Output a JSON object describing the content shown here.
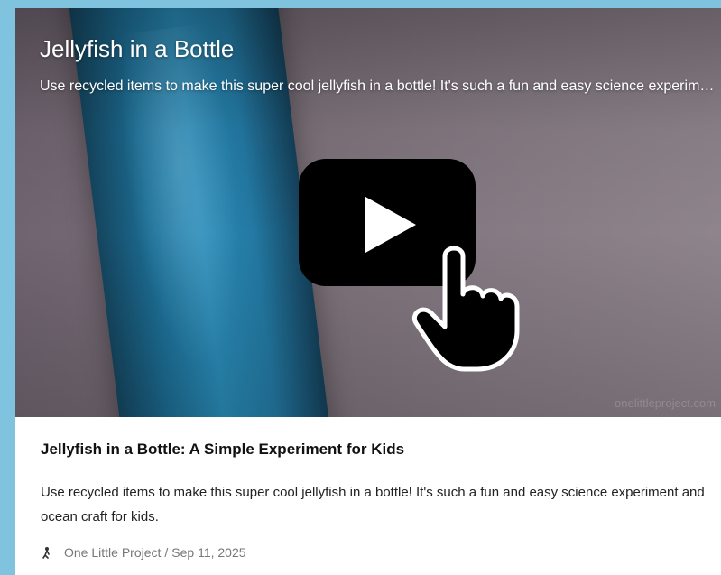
{
  "video": {
    "title": "Jellyfish in a Bottle",
    "subtitle": "Use recycled items to make this super cool jellyfish in a bottle! It's such a fun and easy science experiment and ocean craft for kids.",
    "watermark": "onelittleproject.com",
    "play_icon": "play-button-icon",
    "cursor_icon": "hand-pointer-icon"
  },
  "article": {
    "title": "Jellyfish in a Bottle: A Simple Experiment for Kids",
    "description": "Use recycled items to make this super cool jellyfish in a bottle! It's such a fun and easy science experiment and ocean craft for kids.",
    "author": "One Little Project",
    "separator": "/",
    "date": "Sep 11, 2025"
  },
  "colors": {
    "page_background": "#7fc3df",
    "card_background": "#ffffff",
    "play_button": "#000000"
  }
}
